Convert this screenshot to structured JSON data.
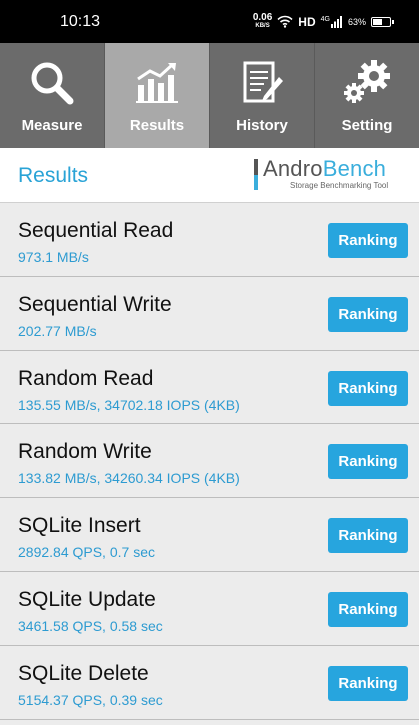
{
  "status_bar": {
    "time": "10:13",
    "net_speed_value": "0.06",
    "net_speed_unit": "KB/S",
    "hd": "HD",
    "signal_label": "4G",
    "battery": "63%",
    "battery_level": 0.63
  },
  "tabs": [
    {
      "label": "Measure",
      "icon": "search-icon",
      "active": false
    },
    {
      "label": "Results",
      "icon": "chart-icon",
      "active": true
    },
    {
      "label": "History",
      "icon": "history-icon",
      "active": false
    },
    {
      "label": "Setting",
      "icon": "gear-icon",
      "active": false
    }
  ],
  "header": {
    "title": "Results",
    "logo_part1": "Andro",
    "logo_part2": "Bench",
    "logo_tagline": "Storage Benchmarking Tool"
  },
  "results": [
    {
      "name": "Sequential Read",
      "value": "973.1 MB/s",
      "button": "Ranking"
    },
    {
      "name": "Sequential Write",
      "value": "202.77 MB/s",
      "button": "Ranking"
    },
    {
      "name": "Random Read",
      "value": "135.55 MB/s, 34702.18 IOPS (4KB)",
      "button": "Ranking"
    },
    {
      "name": "Random Write",
      "value": "133.82 MB/s, 34260.34 IOPS (4KB)",
      "button": "Ranking"
    },
    {
      "name": "SQLite Insert",
      "value": "2892.84 QPS, 0.7 sec",
      "button": "Ranking"
    },
    {
      "name": "SQLite Update",
      "value": "3461.58 QPS, 0.58 sec",
      "button": "Ranking"
    },
    {
      "name": "SQLite Delete",
      "value": "5154.37 QPS, 0.39 sec",
      "button": "Ranking"
    }
  ],
  "colors": {
    "accent": "#27a5de",
    "tab_bg": "#6b6b6b",
    "tab_active_bg": "#a9a9a9"
  }
}
